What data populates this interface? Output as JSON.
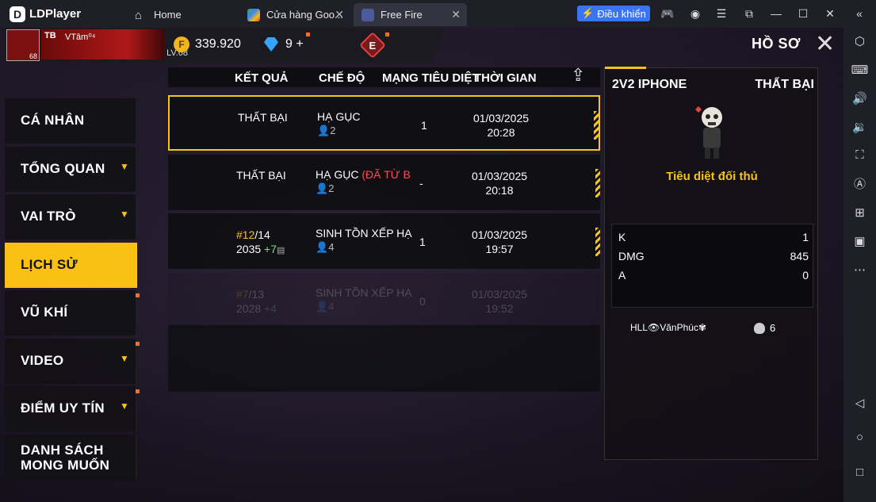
{
  "titlebar": {
    "app_name": "LDPlayer",
    "tabs": [
      {
        "label": "Home"
      },
      {
        "label": "Cửa hàng Goo..."
      },
      {
        "label": "Free Fire"
      }
    ],
    "control_button": "Điều khiển"
  },
  "hud": {
    "player_tag": "TB",
    "player_name": "VTâm⁰⁴",
    "avatar_level": "68",
    "level_label": "LV.68",
    "gold": "339.920",
    "diamonds": "9",
    "diamond_plus": "+",
    "badge_letter": "E",
    "page_title": "HỒ SƠ"
  },
  "nav": {
    "items": [
      {
        "label": "CÁ NHÂN"
      },
      {
        "label": "TỔNG QUAN"
      },
      {
        "label": "VAI TRÒ"
      },
      {
        "label": "LỊCH SỬ"
      },
      {
        "label": "VŨ KHÍ"
      },
      {
        "label": "VIDEO"
      },
      {
        "label": "ĐIỂM UY TÍN"
      },
      {
        "label_line1": "DANH SÁCH",
        "label_line2": "MONG MUỐN"
      }
    ]
  },
  "table": {
    "headers": {
      "result": "KẾT QUẢ",
      "mode": "CHẾ ĐỘ",
      "kills": "MẠNG TIÊU DIỆT",
      "time": "THỜI GIAN"
    },
    "rows": [
      {
        "result": "THẤT BẠI",
        "mode": "HẠ GỤC",
        "mode_extra": "",
        "squad": "2",
        "kills": "1",
        "date": "01/03/2025",
        "time": "20:28"
      },
      {
        "result": "THẤT BẠI",
        "mode": "HẠ GỤC",
        "mode_extra": "(ĐÃ TỪ B",
        "squad": "2",
        "kills": "-",
        "date": "01/03/2025",
        "time": "20:18"
      },
      {
        "rank": "#12",
        "rank_total": "/14",
        "points": "2035",
        "points_delta": "+7",
        "mode": "SINH TỒN XẾP HẠ",
        "squad": "4",
        "kills": "1",
        "date": "01/03/2025",
        "time": "19:57"
      },
      {
        "rank": "#7",
        "rank_total": "/13",
        "points": "2028",
        "points_delta": "+4",
        "mode": "SINH TỒN XẾP HẠ",
        "squad": "4",
        "kills": "0",
        "date": "01/03/2025",
        "time": "19:52"
      }
    ]
  },
  "detail": {
    "mode": "2V2 IPHONE",
    "result": "THẤT BẠI",
    "caption": "Tiêu diệt đối thủ",
    "stats": [
      {
        "label": "K",
        "value": "1"
      },
      {
        "label": "DMG",
        "value": "845"
      },
      {
        "label": "A",
        "value": "0"
      }
    ],
    "player": "HLL👁VănPhúc✾",
    "player_kills": "6"
  }
}
